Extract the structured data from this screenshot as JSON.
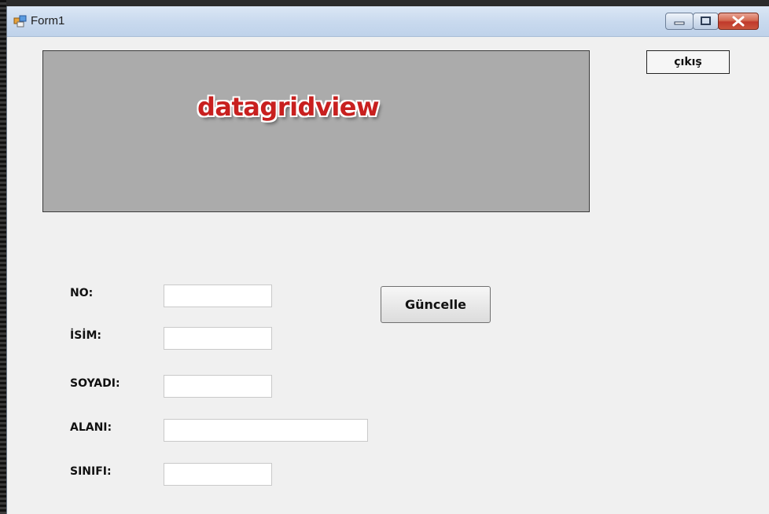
{
  "window": {
    "title": "Form1",
    "icon": "form-window-icon",
    "controls": [
      "minimize-icon",
      "maximize-icon",
      "close-icon"
    ]
  },
  "grid": {
    "label": "datagridview"
  },
  "buttons": {
    "exit_label": "çıkış",
    "update_label": "Güncelle"
  },
  "fields": [
    {
      "label": "NO:",
      "value": ""
    },
    {
      "label": "İSİM:",
      "value": ""
    },
    {
      "label": "SOYADI:",
      "value": ""
    },
    {
      "label": "ALANI:",
      "value": ""
    },
    {
      "label": "SINIFI:",
      "value": ""
    }
  ],
  "colors": {
    "grid_background": "#ababab",
    "form_background": "#f0f0f0",
    "grid_label": "#c8201f",
    "close_button": "#c0392b"
  }
}
